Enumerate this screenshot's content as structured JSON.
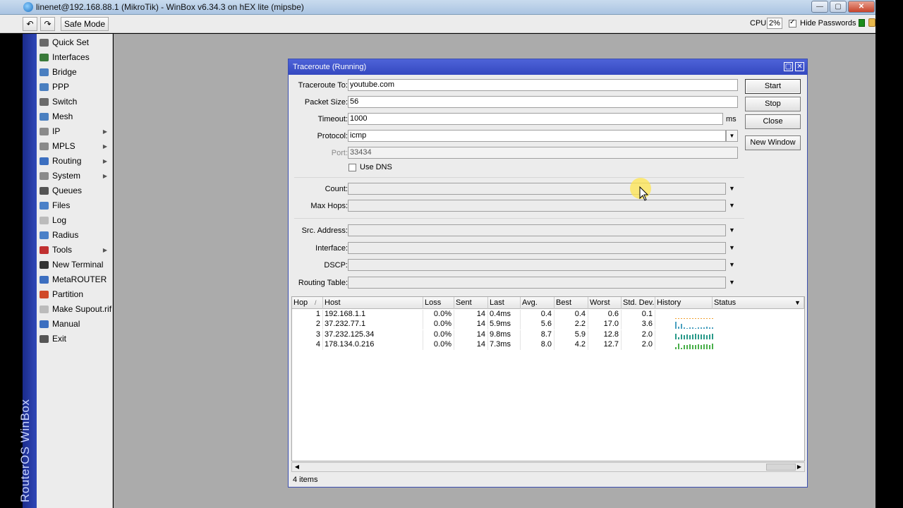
{
  "window": {
    "title": "linenet@192.168.88.1 (MikroTik) - WinBox v6.34.3 on hEX lite (mipsbe)",
    "minimize": "—",
    "maximize": "▢",
    "close": "✕"
  },
  "toolbar": {
    "undo_icon": "↶",
    "redo_icon": "↷",
    "safe_mode": "Safe Mode",
    "cpu_label": "CPU:",
    "cpu_value": "2%",
    "hide_passwords": "Hide Passwords",
    "hide_passwords_checked": true
  },
  "sidebar": {
    "brand": "RouterOS WinBox",
    "items": [
      {
        "label": "Quick Set",
        "icon": "quick-set-icon",
        "color": "#6a6a6a",
        "submenu": false
      },
      {
        "label": "Interfaces",
        "icon": "interfaces-icon",
        "color": "#3a7a3a",
        "submenu": false
      },
      {
        "label": "Bridge",
        "icon": "bridge-icon",
        "color": "#4a7fc0",
        "submenu": false
      },
      {
        "label": "PPP",
        "icon": "ppp-icon",
        "color": "#4a7fc0",
        "submenu": false
      },
      {
        "label": "Switch",
        "icon": "switch-icon",
        "color": "#6a6a6a",
        "submenu": false
      },
      {
        "label": "Mesh",
        "icon": "mesh-icon",
        "color": "#4a7fc0",
        "submenu": false
      },
      {
        "label": "IP",
        "icon": "ip-icon",
        "color": "#8a8a8a",
        "submenu": true
      },
      {
        "label": "MPLS",
        "icon": "mpls-icon",
        "color": "#8a8a8a",
        "submenu": true
      },
      {
        "label": "Routing",
        "icon": "routing-icon",
        "color": "#3c6fc0",
        "submenu": true
      },
      {
        "label": "System",
        "icon": "system-icon",
        "color": "#8a8a8a",
        "submenu": true
      },
      {
        "label": "Queues",
        "icon": "queues-icon",
        "color": "#555555",
        "submenu": false
      },
      {
        "label": "Files",
        "icon": "files-icon",
        "color": "#4a80c8",
        "submenu": false
      },
      {
        "label": "Log",
        "icon": "log-icon",
        "color": "#bbbbbb",
        "submenu": false
      },
      {
        "label": "Radius",
        "icon": "radius-icon",
        "color": "#4a80c8",
        "submenu": false
      },
      {
        "label": "Tools",
        "icon": "tools-icon",
        "color": "#c03030",
        "submenu": true
      },
      {
        "label": "New Terminal",
        "icon": "terminal-icon",
        "color": "#333333",
        "submenu": false
      },
      {
        "label": "MetaROUTER",
        "icon": "metarouter-icon",
        "color": "#3c6fc0",
        "submenu": false
      },
      {
        "label": "Partition",
        "icon": "partition-icon",
        "color": "#d04a2a",
        "submenu": false
      },
      {
        "label": "Make Supout.rif",
        "icon": "supout-icon",
        "color": "#bbbbbb",
        "submenu": false
      },
      {
        "label": "Manual",
        "icon": "manual-icon",
        "color": "#3c6fc0",
        "submenu": false
      },
      {
        "label": "Exit",
        "icon": "exit-icon",
        "color": "#555555",
        "submenu": false
      }
    ]
  },
  "traceroute": {
    "title": "Traceroute (Running)",
    "fields": {
      "to_label": "Traceroute To:",
      "to_value": "youtube.com",
      "packet_label": "Packet Size:",
      "packet_value": "56",
      "timeout_label": "Timeout:",
      "timeout_value": "1000",
      "timeout_units": "ms",
      "protocol_label": "Protocol:",
      "protocol_value": "icmp",
      "port_label": "Port:",
      "port_value": "33434",
      "use_dns_label": "Use DNS",
      "use_dns_checked": false,
      "count_label": "Count:",
      "max_hops_label": "Max Hops:",
      "src_label": "Src. Address:",
      "interface_label": "Interface:",
      "dscp_label": "DSCP:",
      "routing_table_label": "Routing Table:"
    },
    "buttons": {
      "start": "Start",
      "stop": "Stop",
      "close": "Close",
      "new_window": "New Window"
    },
    "table": {
      "columns": [
        "Hop",
        "Host",
        "Loss",
        "Sent",
        "Last",
        "Avg.",
        "Best",
        "Worst",
        "Std. Dev.",
        "History",
        "Status"
      ],
      "sort_indicator": "/",
      "rows": [
        {
          "hop": "1",
          "host": "192.168.1.1",
          "loss": "0.0%",
          "sent": "14",
          "last": "0.4ms",
          "avg": "0.4",
          "best": "0.4",
          "worst": "0.6",
          "std": "0.1",
          "history": [
            1,
            1,
            1,
            1,
            1,
            1,
            1,
            1,
            1,
            1,
            1,
            1,
            1,
            1
          ],
          "history_color": "#f0a030"
        },
        {
          "hop": "2",
          "host": "37.232.77.1",
          "loss": "0.0%",
          "sent": "14",
          "last": "5.9ms",
          "avg": "5.6",
          "best": "2.2",
          "worst": "17.0",
          "std": "3.6",
          "history": [
            9,
            3,
            6,
            2,
            1,
            2,
            2,
            1,
            2,
            2,
            2,
            3,
            2,
            2
          ],
          "history_color": "#4aa0c0"
        },
        {
          "hop": "3",
          "host": "37.232.125.34",
          "loss": "0.0%",
          "sent": "14",
          "last": "9.8ms",
          "avg": "8.7",
          "best": "5.9",
          "worst": "12.8",
          "std": "2.0",
          "history": [
            7,
            3,
            6,
            5,
            6,
            5,
            6,
            7,
            6,
            6,
            6,
            5,
            6,
            7
          ],
          "history_color": "#2a9a8a"
        },
        {
          "hop": "4",
          "host": "178.134.0.216",
          "loss": "0.0%",
          "sent": "14",
          "last": "7.3ms",
          "avg": "8.0",
          "best": "4.2",
          "worst": "12.7",
          "std": "2.0",
          "history": [
            3,
            7,
            2,
            5,
            5,
            6,
            5,
            5,
            6,
            5,
            6,
            6,
            5,
            7
          ],
          "history_color": "#4ab04a"
        }
      ]
    },
    "item_count": "4 items"
  }
}
